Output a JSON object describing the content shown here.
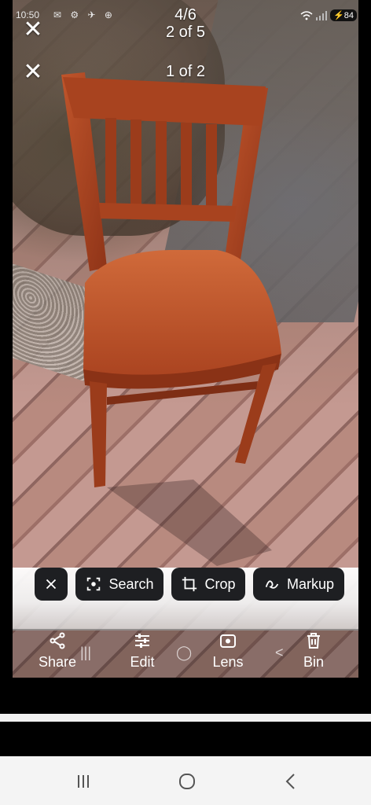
{
  "status_bar": {
    "time": "10:50",
    "notif_icons": "✉ ⚙ ✈ ⊕",
    "battery": "84"
  },
  "viewer": {
    "counters": [
      "4/6",
      "2 of 5",
      "1 of 2"
    ]
  },
  "lens_chips": {
    "close_label": "×",
    "search_label": "Search",
    "crop_label": "Crop",
    "markup_label": "Markup"
  },
  "actions": {
    "share": "Share",
    "edit": "Edit",
    "lens": "Lens",
    "bin": "Bin"
  },
  "ghost_nav": {
    "recents": "|||",
    "home": "◯",
    "back": "<"
  },
  "colors": {
    "chip_bg": "#1e1f22",
    "navbar_bg": "#f4f4f4",
    "chair_wood": "#b24a24"
  }
}
